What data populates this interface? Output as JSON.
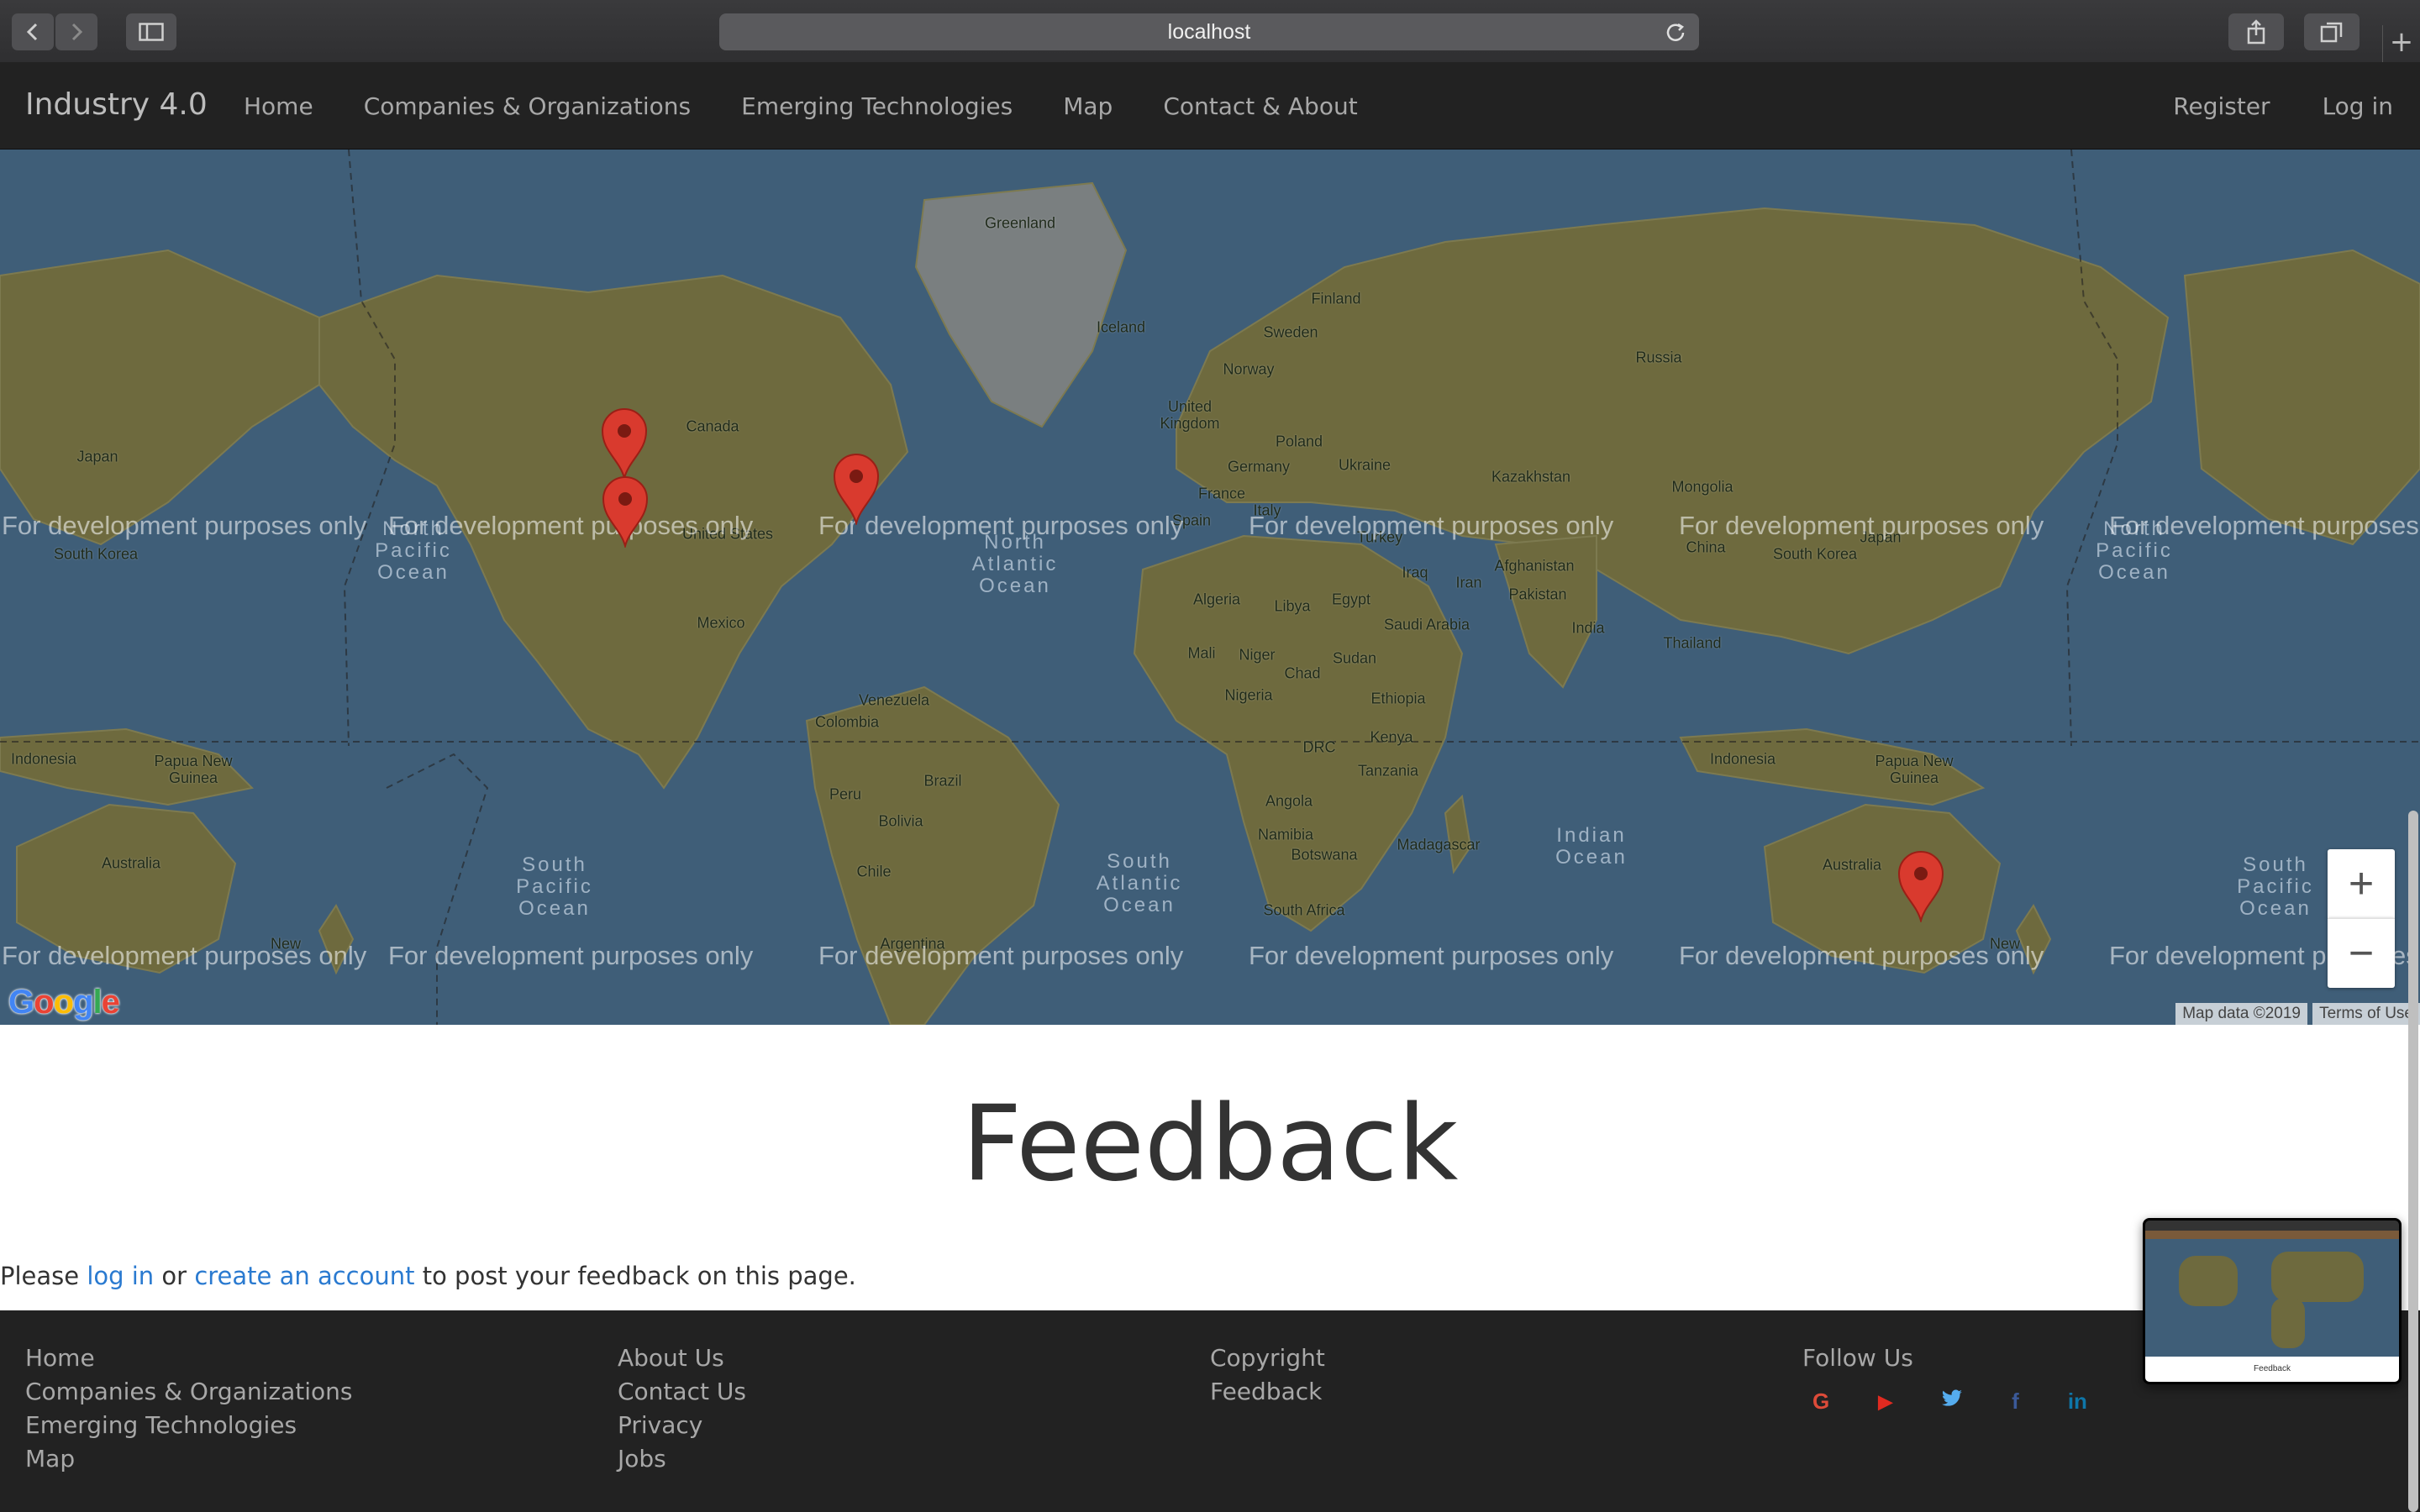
{
  "browser": {
    "address": "localhost",
    "new_tab": "+"
  },
  "navbar": {
    "brand": "Industry 4.0",
    "links": [
      "Home",
      "Companies & Organizations",
      "Emerging Technologies",
      "Map",
      "Contact & About"
    ],
    "right": [
      "Register",
      "Log in"
    ]
  },
  "map": {
    "watermark": "For development purposes only",
    "zoom_in": "+",
    "zoom_out": "−",
    "map_data": "Map data ©2019",
    "terms": "Terms of Use",
    "logo": "Google",
    "labels": {
      "greenland": "Greenland",
      "finland": "Finland",
      "iceland": "Iceland",
      "sweden": "Sweden",
      "norway": "Norway",
      "russia": "Russia",
      "uk": "United\nKingdom",
      "poland": "Poland",
      "germany": "Germany",
      "ukraine": "Ukraine",
      "kazakhstan": "Kazakhstan",
      "france": "France",
      "italy": "Italy",
      "spain": "Spain",
      "mongolia": "Mongolia",
      "turkey": "Turkey",
      "china": "China",
      "south_korea_r": "South Korea",
      "japan_r": "Japan",
      "iraq": "Iraq",
      "iran": "Iran",
      "afghanistan": "Afghanistan",
      "pakistan": "Pakistan",
      "algeria": "Algeria",
      "libya": "Libya",
      "egypt": "Egypt",
      "saudi": "Saudi Arabia",
      "india": "India",
      "thailand": "Thailand",
      "mali": "Mali",
      "niger": "Niger",
      "chad": "Chad",
      "sudan": "Sudan",
      "nigeria": "Nigeria",
      "ethiopia": "Ethiopia",
      "kenya": "Kenya",
      "drc": "DRC",
      "tanzania": "Tanzania",
      "angola": "Angola",
      "namibia": "Namibia",
      "botswana": "Botswana",
      "madagascar": "Madagascar",
      "south_africa": "South Africa",
      "indonesia_r": "Indonesia",
      "png_r": "Papua New\nGuinea",
      "australia_r": "Australia",
      "canada": "Canada",
      "united_states": "United States",
      "mexico": "Mexico",
      "venezuela": "Venezuela",
      "colombia": "Colombia",
      "brazil": "Brazil",
      "peru": "Peru",
      "bolivia": "Bolivia",
      "chile": "Chile",
      "argentina": "Argentina",
      "japan_l": "Japan",
      "south_korea_l": "South Korea",
      "indonesia_l": "Indonesia",
      "png_l": "Papua New\nGuinea",
      "australia_l": "Australia",
      "new_zealand_l": "New",
      "new_zealand_r": "New"
    },
    "oceans": {
      "north_pacific_l": "North\nPacific\nOcean",
      "north_atlantic": "North\nAtlantic\nOcean",
      "south_pacific": "South\nPacific\nOcean",
      "south_atlantic": "South\nAtlantic\nOcean",
      "indian": "Indian\nOcean",
      "north_pacific_r": "North\nPacific\nOcean",
      "south_pacific_r": "South\nPacific\nOcean"
    }
  },
  "feedback": {
    "title": "Feedback",
    "prefix": "Please ",
    "login_link": "log in",
    "middle": " or ",
    "create_link": "create an account",
    "suffix": " to post your feedback on this page."
  },
  "footer": {
    "col1": [
      "Home",
      "Companies & Organizations",
      "Emerging Technologies",
      "Map"
    ],
    "col2": [
      "About Us",
      "Contact Us",
      "Privacy",
      "Jobs"
    ],
    "col3": [
      "Copyright",
      "Feedback"
    ],
    "follow": "Follow Us",
    "social": [
      {
        "name": "google-icon",
        "glyph": "G",
        "color": "#dd4b39"
      },
      {
        "name": "youtube-icon",
        "glyph": "▶",
        "color": "#e02a20"
      },
      {
        "name": "twitter-icon",
        "glyph": "🐦",
        "color": "#55acee"
      },
      {
        "name": "facebook-icon",
        "glyph": "f",
        "color": "#3b5998"
      },
      {
        "name": "linkedin-icon",
        "glyph": "in",
        "color": "#0e76a8"
      }
    ]
  },
  "thumbnail": {
    "caption": "Feedback"
  },
  "colors": {
    "navbar_bg": "#222222",
    "link_blue": "#2a7ad0",
    "pin_red": "#d93a2e",
    "ocean": "#3f5e78",
    "land": "#6b6b3e"
  }
}
